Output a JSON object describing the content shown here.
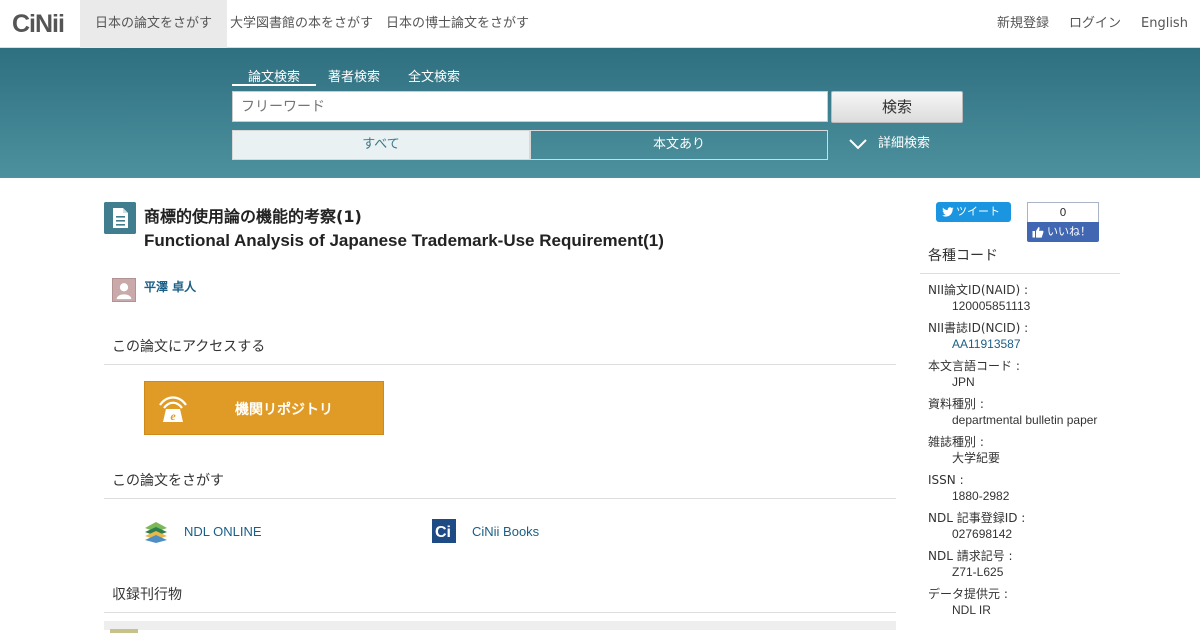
{
  "topnav": {
    "logo": "CiNii",
    "tabs": [
      {
        "label": "日本の論文をさがす",
        "active": true
      },
      {
        "label": "大学図書館の本をさがす",
        "active": false
      },
      {
        "label": "日本の博士論文をさがす",
        "active": false
      }
    ],
    "register": "新規登録",
    "login": "ログイン",
    "language": "English"
  },
  "search": {
    "tabs": [
      {
        "label": "論文検索",
        "active": true
      },
      {
        "label": "著者検索",
        "active": false
      },
      {
        "label": "全文検索",
        "active": false
      }
    ],
    "placeholder": "フリーワード",
    "button": "検索",
    "filter_all": "すべて",
    "filter_fulltext": "本文あり",
    "advanced": "詳細検索"
  },
  "article": {
    "title_ja": "商標的使用論の機能的考察(1)",
    "title_en": "Functional Analysis of Japanese Trademark-Use Requirement(1)",
    "author": "平澤 卓人"
  },
  "access": {
    "heading": "この論文にアクセスする",
    "repository_label": "機関リポジトリ"
  },
  "find": {
    "heading": "この論文をさがす",
    "links": [
      "NDL ONLINE",
      "CiNii Books"
    ]
  },
  "journal": {
    "heading": "収録刊行物"
  },
  "social": {
    "tweet": "ツイート",
    "like_count": "0",
    "like": "いいね！"
  },
  "codes": {
    "heading": "各種コード",
    "items": [
      {
        "key": "NII論文ID(NAID) :",
        "value": "120005851113",
        "link": false
      },
      {
        "key": "NII書誌ID(NCID) :",
        "value": "AA11913587",
        "link": true
      },
      {
        "key": "本文言語コード :",
        "value": "JPN",
        "link": false
      },
      {
        "key": "資料種別 :",
        "value": "departmental bulletin paper",
        "link": false
      },
      {
        "key": "雑誌種別 :",
        "value": "大学紀要",
        "link": false
      },
      {
        "key": "ISSN :",
        "value": "1880-2982",
        "link": false
      },
      {
        "key": "NDL 記事登録ID :",
        "value": "027698142",
        "link": false
      },
      {
        "key": "NDL 請求記号 :",
        "value": "Z71-L625",
        "link": false
      },
      {
        "key": "データ提供元 :",
        "value": "NDL  IR",
        "link": false
      }
    ]
  },
  "colors": {
    "band": "#3d8192",
    "link": "#1b5f86",
    "repository": "#e09b26"
  }
}
